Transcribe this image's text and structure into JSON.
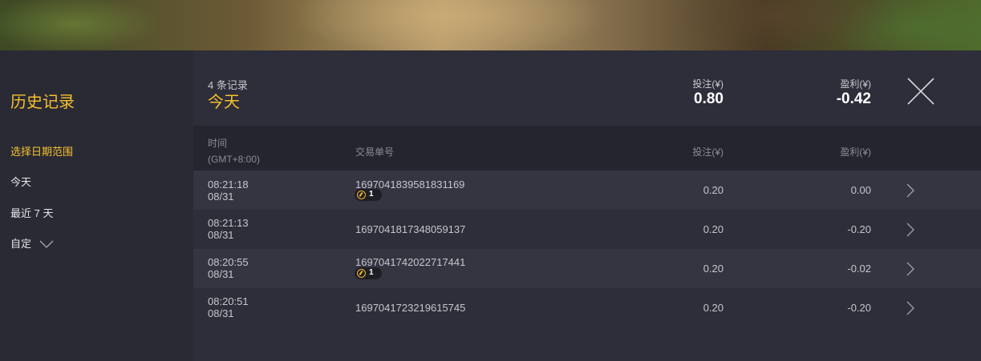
{
  "sidebar": {
    "title": "历史记录",
    "date_range_label": "选择日期范围",
    "items": [
      {
        "label": "今天"
      },
      {
        "label": "最近 7 天"
      },
      {
        "label": "自定"
      }
    ]
  },
  "summary": {
    "record_count": "4 条记录",
    "period": "今天",
    "bet_label": "投注(¥)",
    "bet_value": "0.80",
    "profit_label": "盈利(¥)",
    "profit_value": "-0.42"
  },
  "table": {
    "headers": {
      "time": "时间",
      "timezone": "(GMT+8:00)",
      "trade_id": "交易单号",
      "bet": "投注(¥)",
      "profit": "盈利(¥)"
    },
    "rows": [
      {
        "time": "08:21:18",
        "date": "08/31",
        "id": "1697041839581831169",
        "badge": "1",
        "bet": "0.20",
        "profit": "0.00"
      },
      {
        "time": "08:21:13",
        "date": "08/31",
        "id": "1697041817348059137",
        "bet": "0.20",
        "profit": "-0.20"
      },
      {
        "time": "08:20:55",
        "date": "08/31",
        "id": "1697041742022717441",
        "badge": "1",
        "bet": "0.20",
        "profit": "-0.02"
      },
      {
        "time": "08:20:51",
        "date": "08/31",
        "id": "1697041723219615745",
        "bet": "0.20",
        "profit": "-0.20"
      }
    ]
  },
  "colors": {
    "accent": "#f5c02e",
    "panel": "#2e2e3a",
    "sidebar": "#2a2a35"
  },
  "icons": {
    "close": "close-icon",
    "row_detail": "chevron-right-icon",
    "dropdown": "chevron-down-icon",
    "badge": "coin-icon"
  }
}
